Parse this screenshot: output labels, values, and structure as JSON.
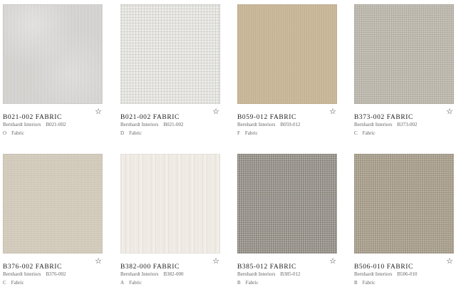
{
  "products": [
    {
      "title": "B021-002 FABRIC",
      "brand": "Bernhardt Interiors",
      "code": "B021-002",
      "grade": "O",
      "type": "Fabric",
      "swatch_color": "#cfcdca"
    },
    {
      "title": "B021-002 FABRIC",
      "brand": "Bernhardt Interiors",
      "code": "B021-002",
      "grade": "D",
      "type": "Fabric",
      "swatch_color": "#ecebe8"
    },
    {
      "title": "B059-012 FABRIC",
      "brand": "Bernhardt Interiors",
      "code": "B059-012",
      "grade": "F",
      "type": "Fabric",
      "swatch_color": "#cbb899"
    },
    {
      "title": "B373-002 FABRIC",
      "brand": "Bernhardt Interiors",
      "code": "B373-002",
      "grade": "C",
      "type": "Fabric",
      "swatch_color": "#c7c2b7"
    },
    {
      "title": "B376-002 FABRIC",
      "brand": "Bernhardt Interiors",
      "code": "B376-002",
      "grade": "C",
      "type": "Fabric",
      "swatch_color": "#d6cdbd"
    },
    {
      "title": "B382-000 FABRIC",
      "brand": "Bernhardt Interiors",
      "code": "B382-000",
      "grade": "A",
      "type": "Fabric",
      "swatch_color": "#efebe4"
    },
    {
      "title": "B385-012 FABRIC",
      "brand": "Bernhardt Interiors",
      "code": "B385-012",
      "grade": "B",
      "type": "Fabric",
      "swatch_color": "#a7a39a"
    },
    {
      "title": "B506-010 FABRIC",
      "brand": "Bernhardt Interiors",
      "code": "B506-010",
      "grade": "B",
      "type": "Fabric",
      "swatch_color": "#b6ab99"
    }
  ],
  "icons": {
    "favorite": "star-outline-icon"
  }
}
